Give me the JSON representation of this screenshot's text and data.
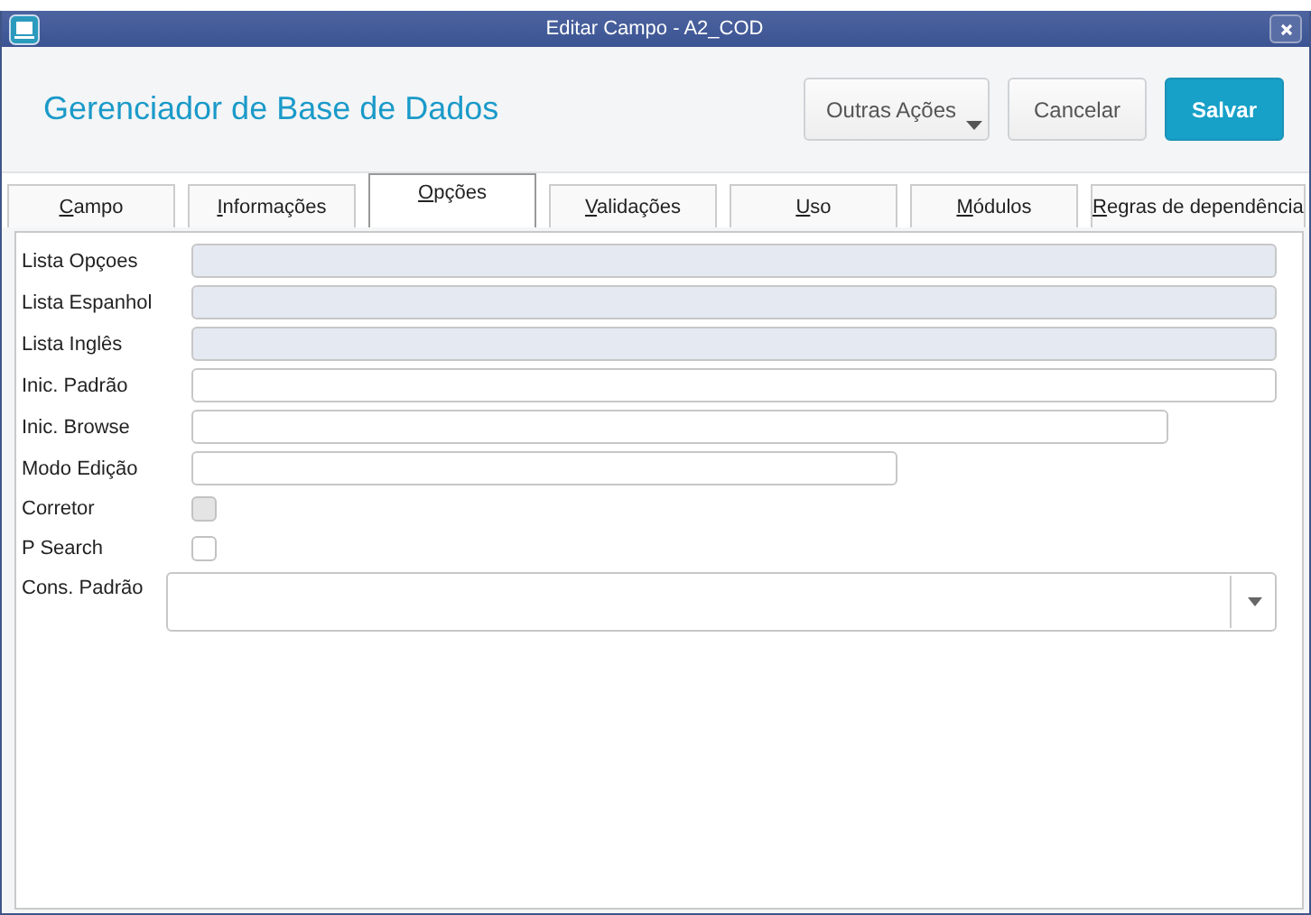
{
  "window": {
    "title": "Editar Campo - A2_COD"
  },
  "header": {
    "title": "Gerenciador de Base de Dados",
    "buttons": [
      {
        "label": "Outras Ações",
        "kind": "menu"
      },
      {
        "label": "Cancelar",
        "kind": "secondary"
      },
      {
        "label": "Salvar",
        "kind": "primary"
      }
    ]
  },
  "tabs": [
    {
      "label": "Campo",
      "selected": false
    },
    {
      "label": "Informações",
      "selected": false
    },
    {
      "label": "Opções",
      "selected": true
    },
    {
      "label": "Validações",
      "selected": false
    },
    {
      "label": "Uso",
      "selected": false
    },
    {
      "label": "Módulos",
      "selected": false
    },
    {
      "label": "Regras de dependência",
      "selected": false
    }
  ],
  "fields": [
    {
      "label": "Lista Opçoes",
      "kind": "text",
      "disabled": true
    },
    {
      "label": "Lista Espanhol",
      "kind": "text",
      "disabled": true
    },
    {
      "label": "Lista Inglês",
      "kind": "text",
      "disabled": true
    },
    {
      "label": "Inic. Padrão",
      "kind": "text",
      "disabled": false
    },
    {
      "label": "Inic. Browse",
      "kind": "text",
      "disabled": false
    },
    {
      "label": "Modo Edição",
      "kind": "text",
      "disabled": false
    },
    {
      "label": "Corretor",
      "kind": "checkbox",
      "disabled": true,
      "checked": false
    },
    {
      "label": "P Search",
      "kind": "checkbox",
      "disabled": false,
      "checked": false
    },
    {
      "label": "Cons. Padrão",
      "kind": "select"
    }
  ]
}
